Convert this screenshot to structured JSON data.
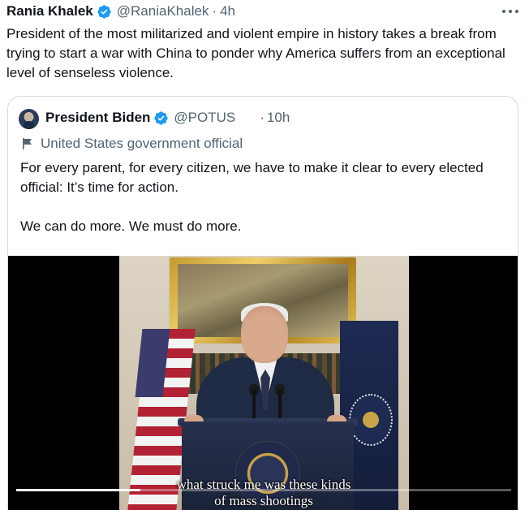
{
  "tweet": {
    "author_name": "Rania Khalek",
    "handle": "@RaniaKhalek",
    "separator": "·",
    "time": "4h",
    "text": "President of the most militarized and violent empire in history takes a break from trying to start a war with China to ponder why America suffers from an exceptional level of senseless violence.",
    "more_icon": "more-horizontal-icon",
    "verified_icon": "verified-badge-icon"
  },
  "quote": {
    "avatar": "avatar",
    "author_name": "President Biden",
    "handle": "@POTUS",
    "separator": "·",
    "time": "10h",
    "label_icon": "flag-icon",
    "label": "United States government official",
    "text": "For every parent, for every citizen, we have to make it clear to every elected official: It’s time for action.\n\nWe can do more. We must do more.",
    "video": {
      "caption_line1": "what struck me was these kinds",
      "caption_line2": "of mass shootings",
      "progress": 0.25
    }
  },
  "colors": {
    "text_primary": "#0f1419",
    "text_secondary": "#536471",
    "verified_blue": "#1d9bf0",
    "border": "#cfd9de"
  }
}
